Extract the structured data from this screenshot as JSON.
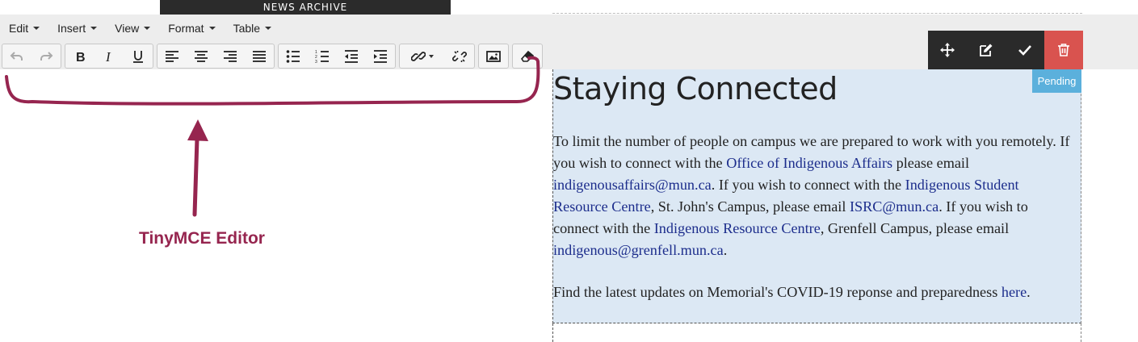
{
  "top_tab": {
    "label": "NEWS ARCHIVE"
  },
  "menubar": {
    "items": [
      {
        "label": "Edit"
      },
      {
        "label": "Insert"
      },
      {
        "label": "View"
      },
      {
        "label": "Format"
      },
      {
        "label": "Table"
      }
    ]
  },
  "toolbar": {
    "groups": [
      [
        "undo-icon",
        "redo-icon"
      ],
      [
        "bold-icon",
        "italic-icon",
        "underline-icon"
      ],
      [
        "align-left-icon",
        "align-center-icon",
        "align-right-icon",
        "align-justify-icon"
      ],
      [
        "bullet-list-icon",
        "numbered-list-icon",
        "outdent-icon",
        "indent-icon"
      ],
      [
        "link-icon",
        "unlink-icon"
      ],
      [
        "image-icon"
      ],
      [
        "clear-formatting-icon"
      ]
    ]
  },
  "annotation": {
    "label": "TinyMCE Editor",
    "color": "#96254f"
  },
  "block_actions": [
    "move-icon",
    "edit-icon",
    "check-icon",
    "trash-icon"
  ],
  "status": {
    "badge": "Pending"
  },
  "content": {
    "title": "Staying Connected",
    "p1_a": "To limit the number of people on campus we are prepared to work with you remotely. If you wish to connect with the ",
    "link_oia": "Office of Indigenous Affairs",
    "p1_b": " please email ",
    "link_email1": "indigenousaffairs@mun.ca",
    "p1_c": ". If you wish to connect with the ",
    "link_isrc": "Indigenous Student Resource Centre",
    "p1_d": ", St. John's Campus, please email ",
    "link_email2": "ISRC@mun.ca",
    "p1_e": ". If you wish to connect with the ",
    "link_irc": "Indigenous Resource Centre",
    "p1_f": ", Grenfell Campus, please email ",
    "link_email3": "indigenous@grenfell.mun.ca",
    "p1_g": ".",
    "p2_a": "Find the latest updates on Memorial's COVID-19 reponse and preparedness ",
    "link_here": "here",
    "p2_b": "."
  },
  "colors": {
    "delete": "#d9534f",
    "pending": "#5bb0dc",
    "block_bg": "#dce8f4",
    "link": "#1c2d8c"
  }
}
